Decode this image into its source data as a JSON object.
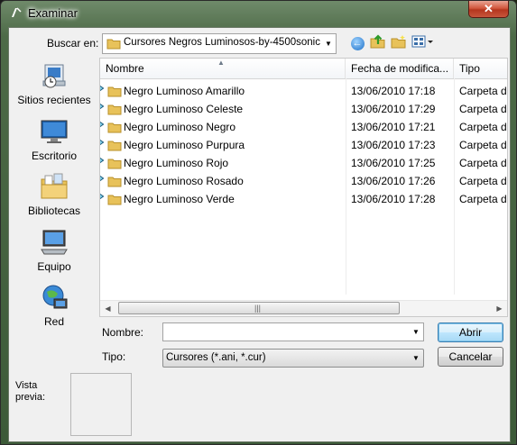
{
  "window": {
    "title": "Examinar",
    "close_label": "✕"
  },
  "toolbar": {
    "look_in_label": "Buscar en:",
    "current_folder": "Cursores Negros  Luminosos-by-4500sonic",
    "icons": [
      "back-icon",
      "up-folder-icon",
      "new-folder-icon",
      "views-menu-icon"
    ]
  },
  "places": [
    {
      "label": "Sitios recientes",
      "icon": "recent-places-icon"
    },
    {
      "label": "Escritorio",
      "icon": "desktop-icon"
    },
    {
      "label": "Bibliotecas",
      "icon": "libraries-icon"
    },
    {
      "label": "Equipo",
      "icon": "computer-icon"
    },
    {
      "label": "Red",
      "icon": "network-icon"
    }
  ],
  "columns": {
    "name": "Nombre",
    "date": "Fecha de modifica...",
    "type": "Tipo"
  },
  "files": [
    {
      "name": "Negro Luminoso Amarillo",
      "date": "13/06/2010 17:18",
      "type": "Carpeta de"
    },
    {
      "name": "Negro Luminoso Celeste",
      "date": "13/06/2010 17:29",
      "type": "Carpeta de"
    },
    {
      "name": "Negro Luminoso Negro",
      "date": "13/06/2010 17:21",
      "type": "Carpeta de"
    },
    {
      "name": "Negro Luminoso Purpura",
      "date": "13/06/2010 17:23",
      "type": "Carpeta de"
    },
    {
      "name": "Negro Luminoso Rojo",
      "date": "13/06/2010 17:25",
      "type": "Carpeta de"
    },
    {
      "name": "Negro Luminoso Rosado",
      "date": "13/06/2010 17:26",
      "type": "Carpeta de"
    },
    {
      "name": "Negro Luminoso Verde",
      "date": "13/06/2010 17:28",
      "type": "Carpeta de"
    }
  ],
  "form": {
    "name_label": "Nombre:",
    "name_value": "",
    "type_label": "Tipo:",
    "type_value": "Cursores (*.ani, *.cur)",
    "open_label": "Abrir",
    "cancel_label": "Cancelar"
  },
  "preview": {
    "label": "Vista previa:"
  },
  "colors": {
    "folder": "#e8c25a",
    "accent_button": "#3c7fb1",
    "close_button": "#c8553c",
    "arrow_cursor": "#6fc3e0"
  }
}
